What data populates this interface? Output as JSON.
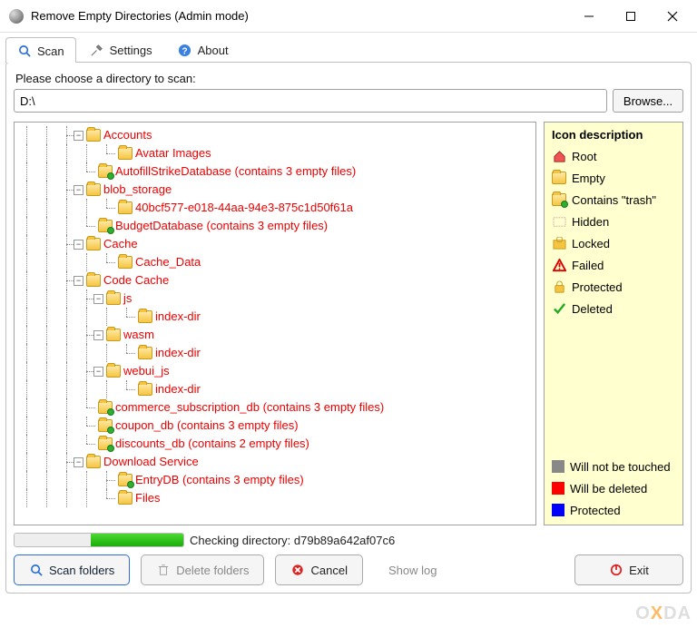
{
  "window": {
    "title": "Remove Empty Directories (Admin mode)"
  },
  "tabs": {
    "scan": "Scan",
    "settings": "Settings",
    "about": "About"
  },
  "prompt": "Please choose a directory to scan:",
  "path": {
    "value": "D:\\"
  },
  "browse": "Browse...",
  "tree": [
    {
      "level": 3,
      "expander": "−",
      "icon": "folder",
      "label": "Accounts"
    },
    {
      "level": 5,
      "expander": "",
      "icon": "folder",
      "label": "Avatar Images",
      "elbow": true
    },
    {
      "level": 4,
      "expander": "",
      "icon": "folder-trash",
      "label": "AutofillStrikeDatabase (contains 3 empty files)",
      "elbow": true
    },
    {
      "level": 3,
      "expander": "−",
      "icon": "folder",
      "label": "blob_storage"
    },
    {
      "level": 5,
      "expander": "",
      "icon": "folder",
      "label": "40bcf577-e018-44aa-94e3-875c1d50f61a",
      "elbow": true
    },
    {
      "level": 4,
      "expander": "",
      "icon": "folder-trash",
      "label": "BudgetDatabase (contains 3 empty files)",
      "elbow": true
    },
    {
      "level": 3,
      "expander": "−",
      "icon": "folder",
      "label": "Cache"
    },
    {
      "level": 5,
      "expander": "",
      "icon": "folder",
      "label": "Cache_Data",
      "elbow": true
    },
    {
      "level": 3,
      "expander": "−",
      "icon": "folder",
      "label": "Code Cache"
    },
    {
      "level": 4,
      "expander": "−",
      "icon": "folder",
      "label": "js"
    },
    {
      "level": 6,
      "expander": "",
      "icon": "folder",
      "label": "index-dir",
      "elbow": true
    },
    {
      "level": 4,
      "expander": "−",
      "icon": "folder",
      "label": "wasm"
    },
    {
      "level": 6,
      "expander": "",
      "icon": "folder",
      "label": "index-dir",
      "elbow": true
    },
    {
      "level": 4,
      "expander": "−",
      "icon": "folder",
      "label": "webui_js"
    },
    {
      "level": 6,
      "expander": "",
      "icon": "folder",
      "label": "index-dir",
      "elbow": true
    },
    {
      "level": 4,
      "expander": "",
      "icon": "folder-trash",
      "label": "commerce_subscription_db (contains 3 empty files)",
      "elbow": true
    },
    {
      "level": 4,
      "expander": "",
      "icon": "folder-trash",
      "label": "coupon_db (contains 3 empty files)",
      "elbow": true
    },
    {
      "level": 4,
      "expander": "",
      "icon": "folder-trash",
      "label": "discounts_db (contains 2 empty files)",
      "elbow": true
    },
    {
      "level": 3,
      "expander": "−",
      "icon": "folder",
      "label": "Download Service"
    },
    {
      "level": 5,
      "expander": "",
      "icon": "folder-trash",
      "label": "EntryDB (contains 3 empty files)"
    },
    {
      "level": 5,
      "expander": "",
      "icon": "folder",
      "label": "Files",
      "elbow": true
    }
  ],
  "legend": {
    "title": "Icon description",
    "items": {
      "root": "Root",
      "empty": "Empty",
      "trash": "Contains \"trash\"",
      "hidden": "Hidden",
      "locked": "Locked",
      "failed": "Failed",
      "protected": "Protected",
      "deleted": "Deleted"
    },
    "swatches": {
      "notouch": "Will not be touched",
      "delete": "Will be deleted",
      "protect": "Protected"
    }
  },
  "progress": {
    "label": "Checking directory: d79b89a642af07c6"
  },
  "buttons": {
    "scan": "Scan folders",
    "delete": "Delete folders",
    "cancel": "Cancel",
    "showlog": "Show log",
    "exit": "Exit"
  },
  "watermark": {
    "pre": "O",
    "x": "X",
    "post": "DA"
  }
}
